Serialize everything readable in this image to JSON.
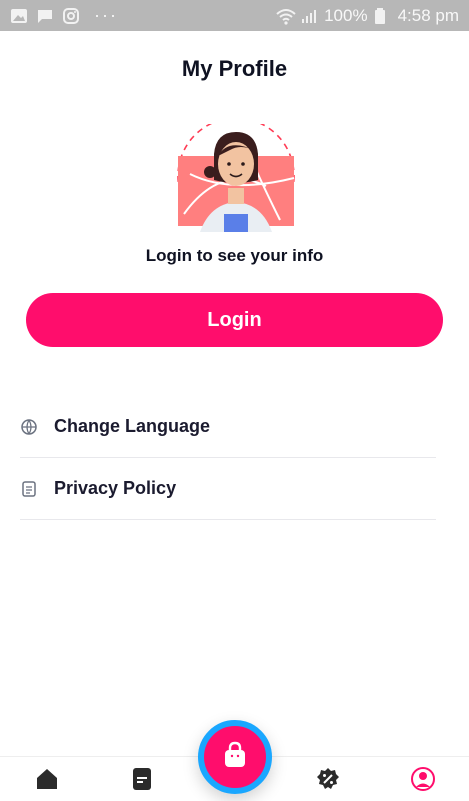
{
  "status_bar": {
    "battery": "100%",
    "time": "4:58 pm",
    "left_icons": [
      "image-icon",
      "message-icon",
      "instagram-icon"
    ],
    "more": "···"
  },
  "header": {
    "title": "My Profile"
  },
  "profile": {
    "prompt": "Login to see your info",
    "login_label": "Login"
  },
  "menu": {
    "items": [
      {
        "label": "Change Language",
        "icon": "globe-icon"
      },
      {
        "label": "Privacy Policy",
        "icon": "document-icon"
      }
    ]
  },
  "bottom_nav": {
    "items": [
      {
        "icon": "home-icon"
      },
      {
        "icon": "orders-icon"
      },
      {
        "icon": "offers-icon"
      },
      {
        "icon": "profile-icon",
        "active": true
      }
    ],
    "fab_icon": "shopping-bag-icon"
  },
  "colors": {
    "accent": "#ff0d6c",
    "fab_ring": "#1aa7ff",
    "status_bar": "#b7b7b7"
  }
}
